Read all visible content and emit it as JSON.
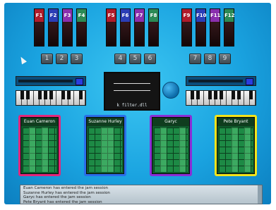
{
  "fkeys": [
    {
      "label": "F1",
      "color": "#b01c2b"
    },
    {
      "label": "F2",
      "color": "#2b3eb6"
    },
    {
      "label": "F3",
      "color": "#8a2fae"
    },
    {
      "label": "F4",
      "color": "#2b8a55"
    },
    {
      "label": "F5",
      "color": "#b01c2b"
    },
    {
      "label": "F6",
      "color": "#2b3eb6"
    },
    {
      "label": "F7",
      "color": "#8a2fae"
    },
    {
      "label": "F8",
      "color": "#2b8a55"
    },
    {
      "label": "F9",
      "color": "#b01c2b"
    },
    {
      "label": "F10",
      "color": "#2b3eb6"
    },
    {
      "label": "F11",
      "color": "#8a2fae"
    },
    {
      "label": "F12",
      "color": "#2b8a55"
    }
  ],
  "number_pads": [
    "1",
    "2",
    "3",
    "4",
    "5",
    "6",
    "7",
    "8",
    "9"
  ],
  "screen": {
    "label": "k filter.dll"
  },
  "players": [
    {
      "name": "Euan Cameron",
      "color": "#e2277a"
    },
    {
      "name": "Suzanne Hurley",
      "color": "#2a6ee8"
    },
    {
      "name": "Garyc",
      "color": "#8a2fd6"
    },
    {
      "name": "Pete Bryant",
      "color": "#f2e41a"
    }
  ],
  "log": [
    "Euan Cameron has entered the jam session",
    "Suzanne Hurley has entered the jam session",
    "Garyc has entered the jam session",
    "Pete Bryant has entered the jam session"
  ]
}
